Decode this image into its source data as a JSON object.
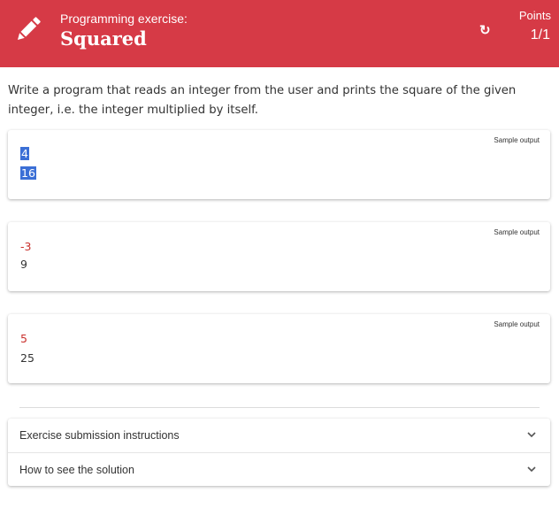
{
  "header": {
    "subtitle": "Programming exercise:",
    "title": "Squared",
    "refresh_icon": "↻",
    "points_label": "Points",
    "points_value": "1/1",
    "background": "#d63a46"
  },
  "description": "Write a program that reads an integer from the user and prints the square of the given integer, i.e. the integer multiplied by itself.",
  "samples": [
    {
      "label": "Sample output",
      "input": "4",
      "output": "16",
      "selected": true
    },
    {
      "label": "Sample output",
      "input": "-3",
      "output": "9"
    },
    {
      "label": "Sample output",
      "input": "5",
      "output": "25"
    }
  ],
  "accordion": [
    {
      "label": "Exercise submission instructions",
      "icon": "chevron-down-icon"
    },
    {
      "label": "How to see the solution",
      "icon": "chevron-down-icon"
    }
  ],
  "colors": {
    "input_text": "#c9302c",
    "selection": "#3b6fd6"
  }
}
